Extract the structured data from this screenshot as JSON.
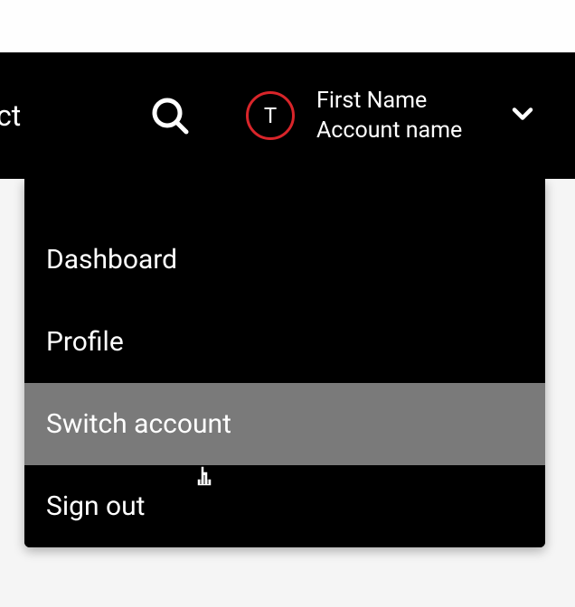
{
  "header": {
    "partial_text": "ct",
    "avatar_letter": "T",
    "first_name_label": "First Name",
    "account_name_label": "Account name"
  },
  "dropdown": {
    "items": [
      {
        "label": "Dashboard",
        "hovered": false
      },
      {
        "label": "Profile",
        "hovered": false
      },
      {
        "label": "Switch account",
        "hovered": true
      },
      {
        "label": "Sign out",
        "hovered": false
      }
    ]
  },
  "colors": {
    "accent": "#d9252a",
    "header_bg": "#000000",
    "hover_bg": "#7a7a7a"
  }
}
